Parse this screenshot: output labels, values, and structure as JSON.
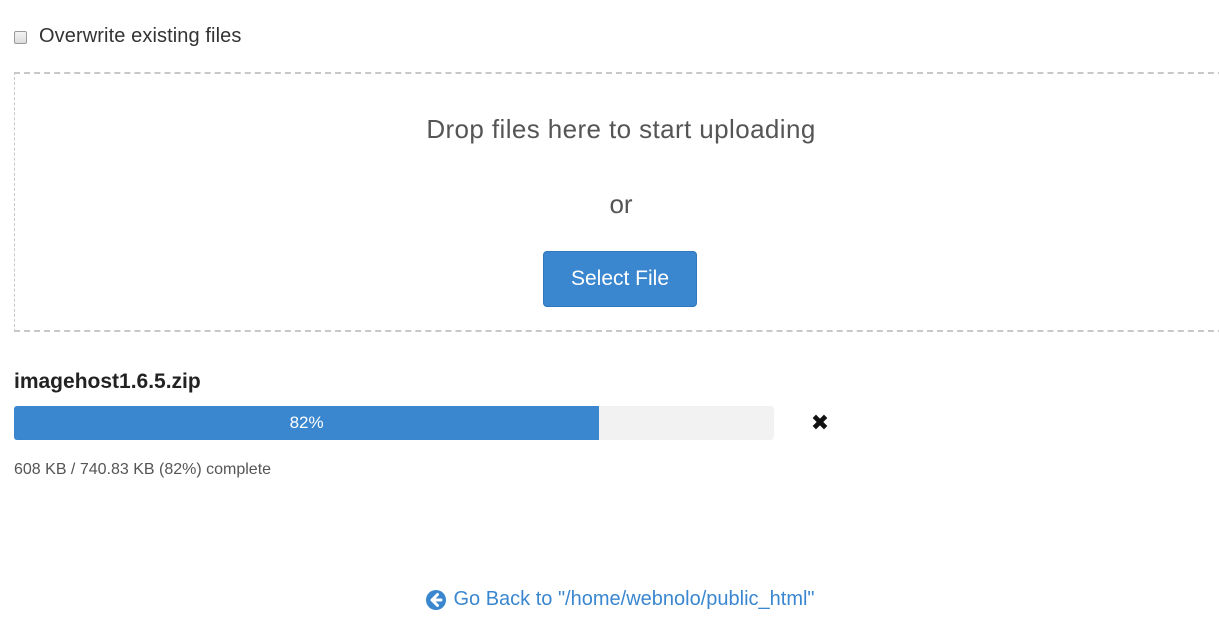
{
  "options": {
    "overwrite_label": "Overwrite existing files",
    "overwrite_checked": false
  },
  "dropzone": {
    "title": "Drop files here to start uploading",
    "or_text": "or",
    "select_button": "Select File"
  },
  "upload": {
    "file_name": "imagehost1.6.5.zip",
    "progress_label": "82%",
    "progress_fraction": 0.77,
    "cancel_icon": "close-icon",
    "status": "608 KB / 740.83 KB (82%) complete"
  },
  "footer": {
    "back_icon": "arrow-left-circle-icon",
    "go_back_label": "Go Back to \"/home/webnolo/public_html\""
  },
  "colors": {
    "accent": "#3a87cf",
    "track": "#f2f2f2"
  }
}
